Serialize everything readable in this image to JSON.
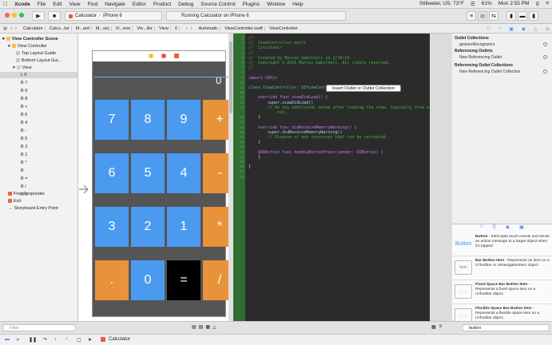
{
  "menubar": {
    "app": "Xcode",
    "items": [
      "File",
      "Edit",
      "View",
      "Find",
      "Navigate",
      "Editor",
      "Product",
      "Debug",
      "Source Control",
      "Plugins",
      "Window",
      "Help"
    ],
    "weather": "Stillwater, US: 73°F",
    "battery": "61%",
    "clock": "Mon 2:55 PM"
  },
  "toolbar": {
    "scheme": "Calculator",
    "device": "iPhone 6",
    "status": "Running Calculator on iPhone 6"
  },
  "jumpbar_left": [
    "Calculator",
    "Calcu...tor",
    "M...ard",
    "M...se)",
    "Vi...ene",
    "Vie...ller",
    "View",
    "0"
  ],
  "jumpbar_right": [
    "Automatic",
    "ViewController.swift",
    "ViewController"
  ],
  "outline": {
    "scene": "View Controller Scene",
    "controller": "View Controller",
    "top_guide": "Top Layout Guide",
    "bottom_guide": "Bottom Layout Gui...",
    "view": "View",
    "children": [
      "L  0",
      "B  7",
      "B  9",
      "B  8",
      "B  +",
      "B  6",
      "B  4",
      "B  -",
      "B  5",
      "B  3",
      "B  1",
      "B  *",
      "B  .",
      "B  =",
      "B  /",
      "B  0"
    ],
    "first_responder": "First Responder",
    "exit": "Exit",
    "entry": "Storyboard Entry Point",
    "filter_placeholder": "Filter"
  },
  "calculator": {
    "display": "0",
    "rows": [
      [
        {
          "label": "7",
          "color": "blue"
        },
        {
          "label": "8",
          "color": "blue"
        },
        {
          "label": "9",
          "color": "blue"
        },
        {
          "label": "+",
          "color": "orange"
        }
      ],
      [
        {
          "label": "6",
          "color": "blue"
        },
        {
          "label": "5",
          "color": "blue"
        },
        {
          "label": "4",
          "color": "blue"
        },
        {
          "label": "-",
          "color": "orange"
        }
      ],
      [
        {
          "label": "3",
          "color": "blue"
        },
        {
          "label": "2",
          "color": "blue"
        },
        {
          "label": "1",
          "color": "blue"
        },
        {
          "label": "*",
          "color": "orange"
        }
      ],
      [
        {
          "label": ".",
          "color": "orange"
        },
        {
          "label": "0",
          "color": "blue"
        },
        {
          "label": "=",
          "color": "black"
        },
        {
          "label": "/",
          "color": "orange"
        }
      ]
    ]
  },
  "code": {
    "lines": [
      {
        "n": "1",
        "t": "//",
        "c": "cmt"
      },
      {
        "n": "2",
        "t": "//  ViewController.swift",
        "c": "cmt"
      },
      {
        "n": "3",
        "t": "//  Calculator",
        "c": "cmt"
      },
      {
        "n": "4",
        "t": "//",
        "c": "cmt"
      },
      {
        "n": "5",
        "t": "//  Created by Marcus Gabilheri on 2/18/16.",
        "c": "cmt"
      },
      {
        "n": "6",
        "t": "//  Copyright © 2016 Marcus Gabilheri. All rights reserved.",
        "c": "cmt"
      },
      {
        "n": "7",
        "t": "//",
        "c": "cmt"
      },
      {
        "n": "8",
        "t": "",
        "c": ""
      },
      {
        "n": "9",
        "t": "import UIKit",
        "c": "kw"
      },
      {
        "n": "10",
        "t": "",
        "c": ""
      },
      {
        "n": "11",
        "t": "class ViewController: UIViewController {",
        "c": "ty"
      },
      {
        "n": "12",
        "t": "",
        "c": ""
      },
      {
        "n": "13",
        "t": "    override func viewDidLoad() {",
        "c": "kw"
      },
      {
        "n": "14",
        "t": "        super.viewDidLoad()",
        "c": "fn"
      },
      {
        "n": "15",
        "t": "        // Do any additional setup after loading the view, typically from a",
        "c": "cmt"
      },
      {
        "n": "",
        "t": "            nib.",
        "c": "cmt"
      },
      {
        "n": "16",
        "t": "    }",
        "c": ""
      },
      {
        "n": "17",
        "t": "",
        "c": ""
      },
      {
        "n": "18",
        "t": "    override func didReceiveMemoryWarning() {",
        "c": "kw"
      },
      {
        "n": "19",
        "t": "        super.didReceiveMemoryWarning()",
        "c": "fn"
      },
      {
        "n": "20",
        "t": "        // Dispose of any resources that can be recreated.",
        "c": "cmt"
      },
      {
        "n": "21",
        "t": "    }",
        "c": ""
      },
      {
        "n": "22",
        "t": "",
        "c": ""
      },
      {
        "n": "23",
        "t": "    @IBAction func handleButtonPress(sender: UIButton) {",
        "c": "kw"
      },
      {
        "n": "24",
        "t": "    }",
        "c": ""
      },
      {
        "n": "25",
        "t": "",
        "c": ""
      },
      {
        "n": "26",
        "t": "}",
        "c": ""
      },
      {
        "n": "27",
        "t": "",
        "c": ""
      },
      {
        "n": "28",
        "t": "",
        "c": ""
      }
    ],
    "tooltip": "Insert Outlet or Outlet Collection"
  },
  "inspector": {
    "outlet_collections": "Outlet Collections",
    "gesture": "gestureRecognizers",
    "referencing_outlets": "Referencing Outlets",
    "new_ref_outlet": "New Referencing Outlet",
    "referencing_collections": "Referencing Outlet Collections",
    "new_ref_collection": "New Referencing Outlet Collection"
  },
  "library": {
    "items": [
      {
        "icon": "Button",
        "title": "Button",
        "desc": " - Intercepts touch events and sends an action message to a target object when it's tapped."
      },
      {
        "icon": "Item",
        "title": "Bar Button Item",
        "desc": " - Represents an item on a UIToolbar or UINavigationItem object."
      },
      {
        "icon": "",
        "title": "Fixed Space Bar Button Item",
        "desc": " - Represents a fixed space item on a UIToolbar object."
      },
      {
        "icon": "",
        "title": "Flexible Space Bar Button Item",
        "desc": " - Represents a flexible space item on a UIToolbar object."
      }
    ],
    "search": "button"
  },
  "debug": {
    "target": "Calculator"
  },
  "colors": {
    "key_blue": "#4a9bf0",
    "key_orange": "#e8923a",
    "key_black": "#000000",
    "editor_bg": "#2b2b2b"
  }
}
